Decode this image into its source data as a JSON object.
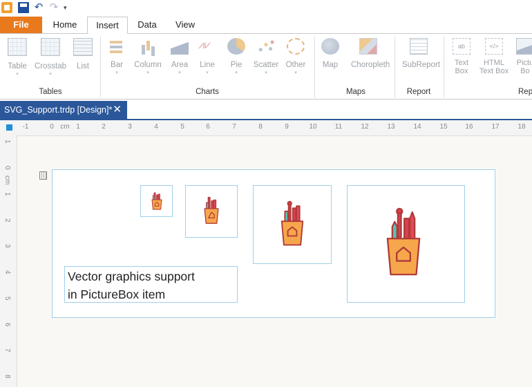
{
  "quick_access": {
    "icons": [
      "app-icon",
      "save-icon",
      "undo-icon",
      "redo-icon",
      "customize-toolbar-icon"
    ],
    "more_glyph": "▾"
  },
  "tabs": {
    "file": "File",
    "items": [
      "Home",
      "Insert",
      "Data",
      "View"
    ],
    "active": "Insert"
  },
  "ribbon": {
    "groups": [
      {
        "name": "Tables",
        "items": [
          "Table",
          "Crosstab",
          "List"
        ]
      },
      {
        "name": "Charts",
        "items": [
          "Bar",
          "Column",
          "Area",
          "Line",
          "Pie",
          "Scatter",
          "Other"
        ]
      },
      {
        "name": "Maps",
        "items": [
          "Map",
          "Choropleth"
        ]
      },
      {
        "name": "Report",
        "items": [
          "SubReport"
        ]
      },
      {
        "name": "Rep",
        "items": [
          "Text Box",
          "HTML Text Box",
          "Picture Box"
        ]
      }
    ],
    "textbox_line1": "Text",
    "textbox_line2": "Box",
    "htmlbox_line1": "HTML",
    "htmlbox_line2": "Text Box",
    "picbox_line1": "Pictu",
    "picbox_line2": "Bo",
    "report_items_group_partial": "Rep",
    "caret": "▾"
  },
  "doc_tab": {
    "title": "SVG_Support.trdp [Design]*",
    "close": "✕"
  },
  "ruler": {
    "h_labels": [
      "-1",
      "0",
      "cm",
      "1",
      "2",
      "3",
      "4",
      "5",
      "6",
      "7",
      "8",
      "9",
      "10",
      "11",
      "12",
      "13",
      "14",
      "15",
      "16",
      "17",
      "18"
    ],
    "v_labels": [
      "1",
      "0",
      "cm",
      "1",
      "2",
      "3",
      "4",
      "5",
      "6",
      "7",
      "8"
    ]
  },
  "report": {
    "text_line1": "Vector graphics support",
    "text_line2": "in PictureBox item",
    "picture_icon": "pencil-cup-icon"
  },
  "colors": {
    "file_tab": "#e8791c",
    "doc_tab": "#2b579a",
    "selection_border": "#9fd0e8",
    "cup_fill": "#f6a74b",
    "cup_stroke": "#b03a3a"
  }
}
